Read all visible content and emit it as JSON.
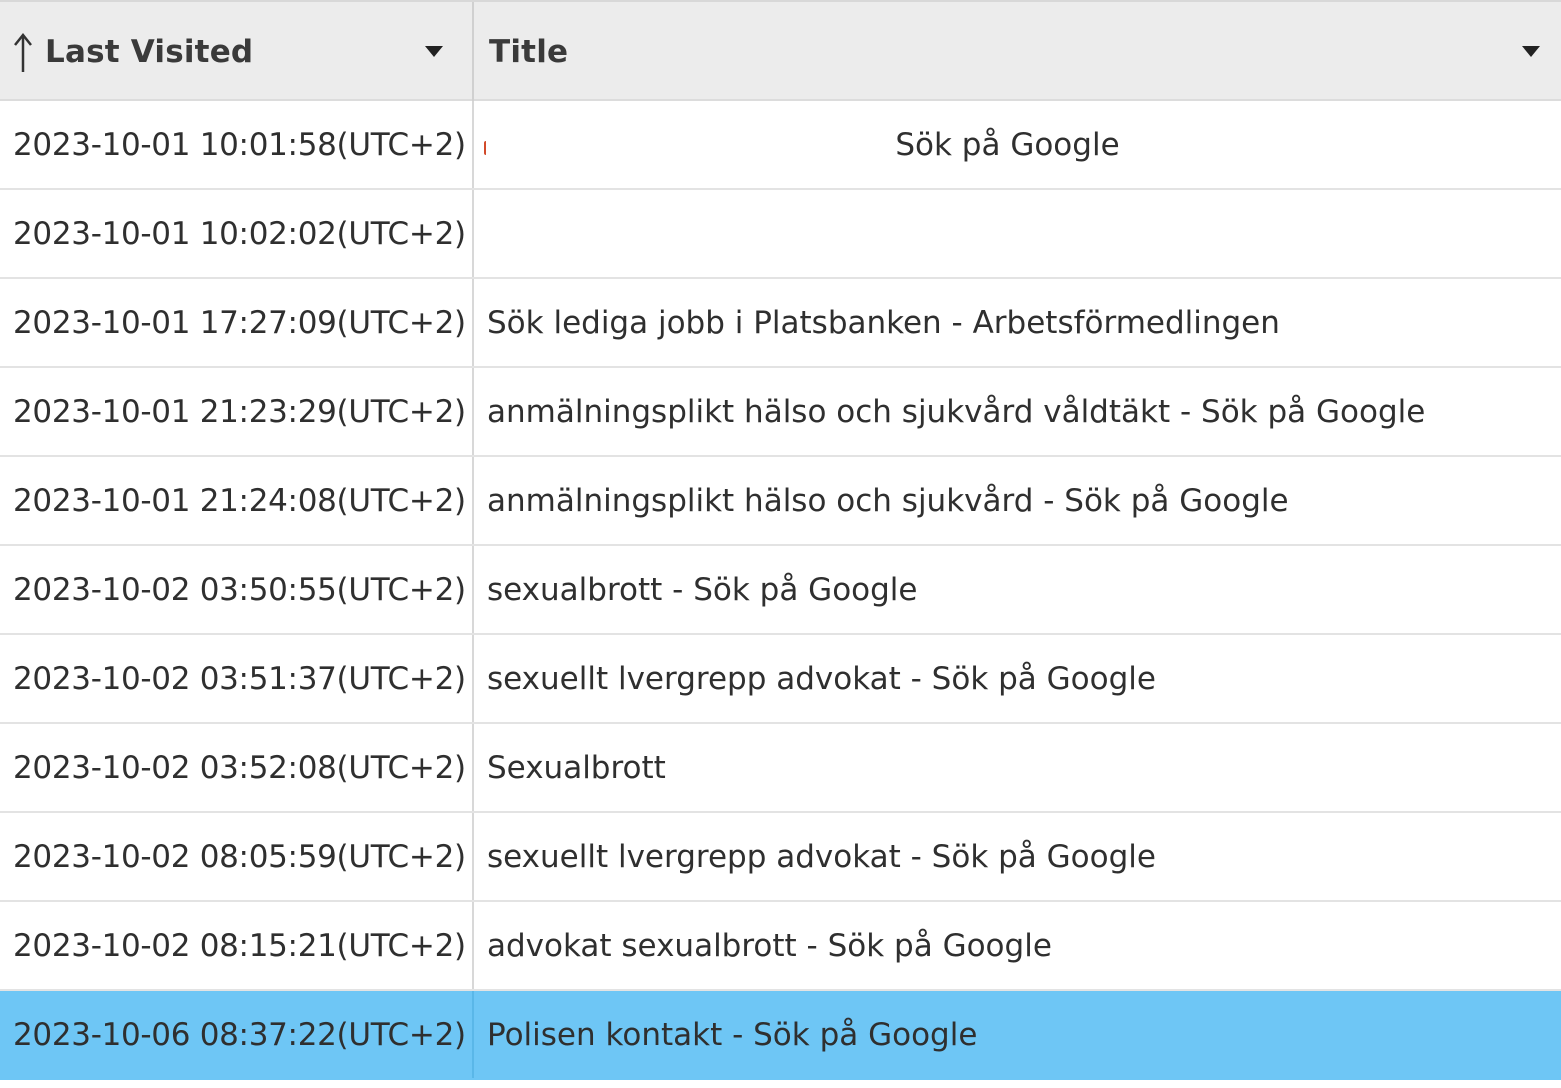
{
  "columns": {
    "last_visited": "Last Visited",
    "title": "Title"
  },
  "icons": {
    "sort": "arrow-up-icon",
    "dropdown": "chevron-down-icon"
  },
  "colors": {
    "header_bg": "#ececec",
    "selected_row": "#6ec6f5"
  },
  "rows": [
    {
      "last_visited": "2023-10-01 10:01:58(UTC+2)",
      "title": "Sök på Google"
    },
    {
      "last_visited": "2023-10-01 10:02:02(UTC+2)",
      "title": ""
    },
    {
      "last_visited": "2023-10-01 17:27:09(UTC+2)",
      "title": "Sök lediga jobb i Platsbanken - Arbetsförmedlingen"
    },
    {
      "last_visited": "2023-10-01 21:23:29(UTC+2)",
      "title": "anmälningsplikt hälso och sjukvård våldtäkt - Sök på Google"
    },
    {
      "last_visited": "2023-10-01 21:24:08(UTC+2)",
      "title": "anmälningsplikt hälso och sjukvård - Sök på Google"
    },
    {
      "last_visited": "2023-10-02 03:50:55(UTC+2)",
      "title": "sexualbrott - Sök på Google"
    },
    {
      "last_visited": "2023-10-02 03:51:37(UTC+2)",
      "title": "sexuellt lvergrepp advokat - Sök på Google"
    },
    {
      "last_visited": "2023-10-02 03:52:08(UTC+2)",
      "title": "Sexualbrott"
    },
    {
      "last_visited": "2023-10-02 08:05:59(UTC+2)",
      "title": "sexuellt lvergrepp advokat - Sök på Google"
    },
    {
      "last_visited": "2023-10-02 08:15:21(UTC+2)",
      "title": "advokat sexualbrott - Sök på Google"
    },
    {
      "last_visited": "2023-10-06 08:37:22(UTC+2)",
      "title": "Polisen kontakt - Sök på Google",
      "selected": true
    }
  ]
}
